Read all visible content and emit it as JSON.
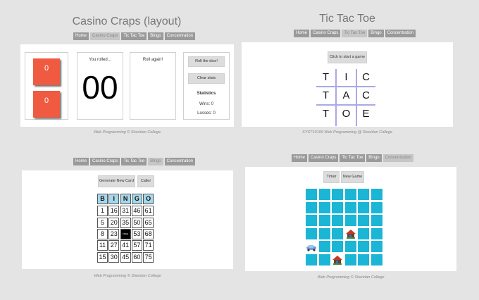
{
  "nav_labels": [
    "Home",
    "Casino Craps",
    "Tic Tac Toe",
    "Bingo",
    "Concentration"
  ],
  "craps": {
    "title": "Casino Craps (layout)",
    "active_nav": "Casino Craps",
    "die1": "0",
    "die2": "0",
    "rolled_label": "You rolled...",
    "rolled_value": "00",
    "message": "Roll again!",
    "roll_button": "Roll the dice!",
    "clear_button": "Clear stats",
    "stats_heading": "Statistics",
    "wins": "Wins: 0",
    "losses": "Losses: 0",
    "footer": "Web Programming © Sheridan College"
  },
  "tictactoe": {
    "title": "Tic Tac Toe",
    "active_nav": "Tic Tac Toe",
    "start_button": "Click to start a game",
    "board": [
      "T",
      "I",
      "C",
      "T",
      "A",
      "C",
      "T",
      "O",
      "E"
    ],
    "footer": "SYST10199 Web Programming @ Sheridan College"
  },
  "bingo": {
    "active_nav": "Bingo",
    "new_card_button": "Generate New Card",
    "caller_button": "Caller",
    "headers": [
      "B",
      "I",
      "N",
      "G",
      "O"
    ],
    "rows": [
      [
        "1",
        "16",
        "31",
        "46",
        "61"
      ],
      [
        "5",
        "20",
        "35",
        "50",
        "65"
      ],
      [
        "8",
        "23",
        "FREE",
        "53",
        "68"
      ],
      [
        "11",
        "27",
        "41",
        "57",
        "71"
      ],
      [
        "15",
        "30",
        "45",
        "60",
        "75"
      ]
    ],
    "footer": "Web Programming © Sheridan College"
  },
  "concentration": {
    "active_nav": "Concentration",
    "timer_button": "Timer",
    "new_game_button": "New Game",
    "grid_rows": 6,
    "grid_cols": 6,
    "revealed": [
      {
        "row": 3,
        "col": 3,
        "icon": "house-icon"
      },
      {
        "row": 4,
        "col": 0,
        "icon": "car-icon"
      },
      {
        "row": 5,
        "col": 2,
        "icon": "house-icon"
      }
    ],
    "footer": "Web Programming © Sheridan College"
  }
}
